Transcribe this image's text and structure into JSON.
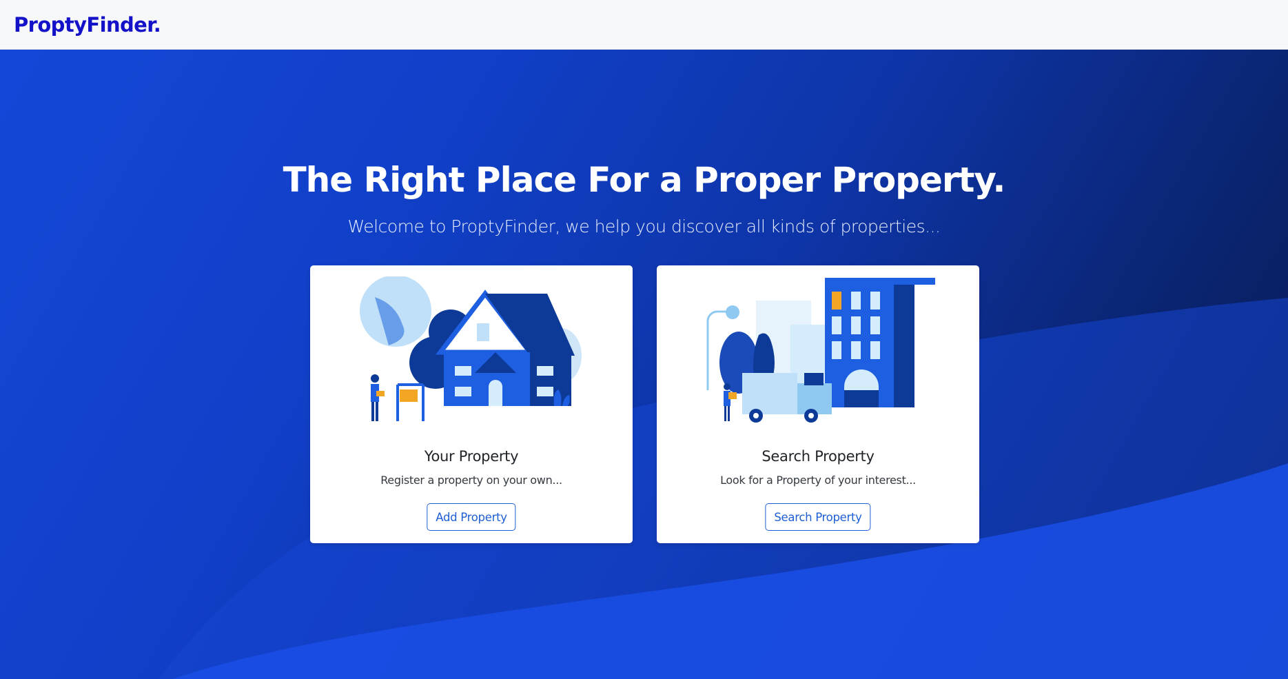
{
  "navbar": {
    "brand": "ProptyFinder."
  },
  "hero": {
    "title": "The Right Place For a Proper Property.",
    "subtitle": "Welcome to ProptyFinder, we help you discover all kinds of properties..."
  },
  "cards": [
    {
      "title": "Your Property",
      "text": "Register a property on your own...",
      "button": "Add Property",
      "illustration": "house-with-sale-sign-illustration"
    },
    {
      "title": "Search Property",
      "text": "Look for a Property of your interest...",
      "button": "Search Property",
      "illustration": "city-building-moving-truck-illustration"
    }
  ],
  "colors": {
    "brand": "#1412c9",
    "hero_start": "#1447d8",
    "hero_end": "#071a4a",
    "button_outline": "#1f5fd6",
    "card_bg": "#ffffff"
  }
}
